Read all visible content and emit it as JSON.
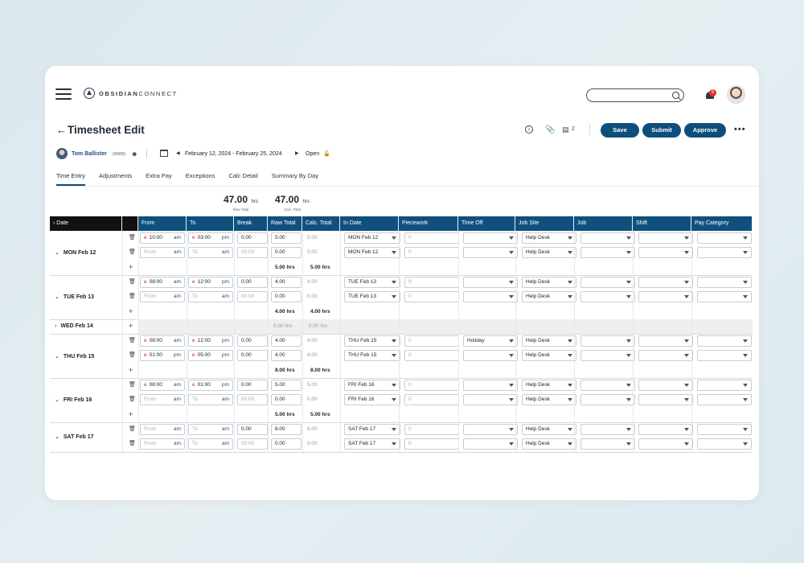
{
  "header": {
    "logo_text_bold": "OBSIDIAN",
    "logo_text": "CONNECT",
    "notification_count": "5"
  },
  "page": {
    "title": "Timesheet Edit",
    "comment_count": "2",
    "buttons": {
      "save": "Save",
      "submit": "Submit",
      "approve": "Approve",
      "more": "•••"
    }
  },
  "employee": {
    "name": "Tom Ballister",
    "id": "(0009)",
    "date_range": "February 12, 2024 - February 25, 2024",
    "status": "Open"
  },
  "tabs": [
    "Time Entry",
    "Adjustments",
    "Extra Pay",
    "Exceptions",
    "Calc Detail",
    "Summary By Day"
  ],
  "totals": {
    "raw": {
      "value": "47.00",
      "unit": "hrs",
      "label": "Raw Total"
    },
    "calc": {
      "value": "47.00",
      "unit": "hrs",
      "label": "Calc. Total"
    }
  },
  "columns": [
    "Date",
    "From",
    "To",
    "Break",
    "Raw Total",
    "Calc. Total",
    "In Date",
    "Piecework",
    "Time Off",
    "Job Site",
    "Job",
    "Shift",
    "Pay Category"
  ],
  "days": [
    {
      "label": "MON Feb 12",
      "expanded": true,
      "entries": [
        {
          "from": "10:00",
          "from_ap": "am",
          "to": "03:00",
          "to_ap": "pm",
          "break": "0.00",
          "raw": "5.00",
          "calc": "5.00",
          "in_date": "MON Feb 12",
          "piece": "0",
          "time_off": "",
          "site": "Help Desk",
          "filled": true
        },
        {
          "from": "From",
          "from_ap": "am",
          "to": "To",
          "to_ap": "am",
          "break": "00:00",
          "raw": "0.00",
          "calc": "0.00",
          "in_date": "MON Feb 12",
          "piece": "0",
          "time_off": "",
          "site": "Help Desk",
          "filled": false
        }
      ],
      "total_raw": "5.00 hrs",
      "total_calc": "5.00 hrs"
    },
    {
      "label": "TUE Feb 13",
      "expanded": true,
      "entries": [
        {
          "from": "08:00",
          "from_ap": "am",
          "to": "12:00",
          "to_ap": "pm",
          "break": "0.00",
          "raw": "4.00",
          "calc": "4.00",
          "in_date": "TUE Feb 13",
          "piece": "0",
          "time_off": "",
          "site": "Help Desk",
          "filled": true
        },
        {
          "from": "From",
          "from_ap": "am",
          "to": "To",
          "to_ap": "am",
          "break": "00:00",
          "raw": "0.00",
          "calc": "0.00",
          "in_date": "TUE Feb 13",
          "piece": "0",
          "time_off": "",
          "site": "Help Desk",
          "filled": false
        }
      ],
      "total_raw": "4.00 hrs",
      "total_calc": "4.00 hrs"
    },
    {
      "label": "WED Feb 14",
      "expanded": false,
      "entries": [],
      "total_raw": "0.00 hrs",
      "total_calc": "0.00 hrs"
    },
    {
      "label": "THU Feb 15",
      "expanded": true,
      "entries": [
        {
          "from": "08:00",
          "from_ap": "am",
          "to": "12:00",
          "to_ap": "pm",
          "break": "0.00",
          "raw": "4.00",
          "calc": "4.00",
          "in_date": "THU Feb 15",
          "piece": "0",
          "time_off": "Holiday",
          "site": "Help Desk",
          "filled": true
        },
        {
          "from": "01:00",
          "from_ap": "pm",
          "to": "05:00",
          "to_ap": "pm",
          "break": "0.00",
          "raw": "4.00",
          "calc": "4.00",
          "in_date": "THU Feb 15",
          "piece": "0",
          "time_off": "",
          "site": "Help Desk",
          "filled": true
        }
      ],
      "total_raw": "8.00 hrs",
      "total_calc": "8.00 hrs"
    },
    {
      "label": "FRI Feb 16",
      "expanded": true,
      "entries": [
        {
          "from": "08:00",
          "from_ap": "am",
          "to": "01:00",
          "to_ap": "pm",
          "break": "0.00",
          "raw": "5.00",
          "calc": "5.00",
          "in_date": "FRI Feb 16",
          "piece": "0",
          "time_off": "",
          "site": "Help Desk",
          "filled": true
        },
        {
          "from": "From",
          "from_ap": "am",
          "to": "To",
          "to_ap": "am",
          "break": "00:00",
          "raw": "0.00",
          "calc": "0.00",
          "in_date": "FRI Feb 16",
          "piece": "0",
          "time_off": "",
          "site": "Help Desk",
          "filled": false
        }
      ],
      "total_raw": "5.00 hrs",
      "total_calc": "5.00 hrs"
    },
    {
      "label": "SAT Feb 17",
      "expanded": true,
      "entries": [
        {
          "from": "From",
          "from_ap": "am",
          "to": "To",
          "to_ap": "am",
          "break": "0.00",
          "raw": "8.00",
          "calc": "8.00",
          "in_date": "SAT Feb 17",
          "piece": "0",
          "time_off": "",
          "site": "Help Desk",
          "filled": false
        },
        {
          "from": "From",
          "from_ap": "am",
          "to": "To",
          "to_ap": "am",
          "break": "00:00",
          "raw": "0.00",
          "calc": "0.00",
          "in_date": "SAT Feb 17",
          "piece": "0",
          "time_off": "",
          "site": "Help Desk",
          "filled": false
        }
      ],
      "total_raw": null,
      "total_calc": null
    }
  ],
  "colors": {
    "primary": "#0e4e7c",
    "header_dark": "#111111",
    "accent_red": "#e03030"
  }
}
